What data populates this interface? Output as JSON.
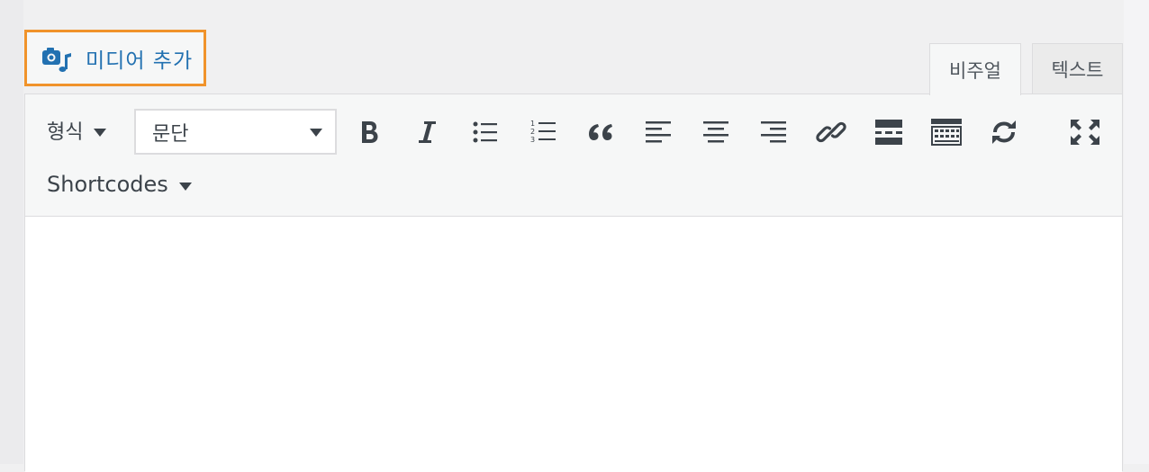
{
  "media": {
    "add_media_label": "미디어 추가"
  },
  "tabs": {
    "visual": "비주얼",
    "text": "텍스트"
  },
  "toolbar": {
    "format_label": "형식",
    "paragraph_select_value": "문단",
    "shortcodes_label": "Shortcodes",
    "buttons": [
      "bold-icon",
      "italic-icon",
      "bullet-list-icon",
      "numbered-list-icon",
      "blockquote-icon",
      "align-left-icon",
      "align-center-icon",
      "align-right-icon",
      "link-icon",
      "read-more-icon",
      "toolbar-toggle-icon",
      "refresh-icon",
      "fullscreen-icon"
    ]
  },
  "colors": {
    "accent": "#2271b1",
    "highlight_border": "#f0932b",
    "icon": "#3c434a"
  }
}
